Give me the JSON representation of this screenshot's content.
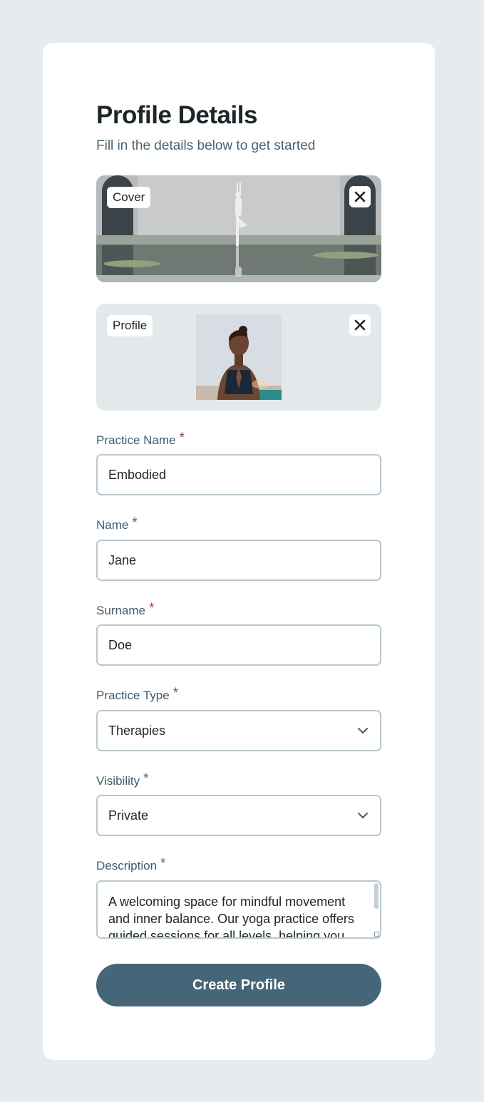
{
  "form": {
    "title": "Profile Details",
    "subtitle": "Fill in the details below to get started",
    "cover_label": "Cover",
    "profile_label": "Profile",
    "required_mark": "*",
    "fields": {
      "practice_name": {
        "label": "Practice Name",
        "value": "Embodied"
      },
      "name": {
        "label": "Name",
        "value": "Jane"
      },
      "surname": {
        "label": "Surname",
        "value": "Doe"
      },
      "practice_type": {
        "label": "Practice Type",
        "value": "Therapies"
      },
      "visibility": {
        "label": "Visibility",
        "value": "Private"
      },
      "description": {
        "label": "Description",
        "value": "A welcoming space for mindful movement and inner balance. Our yoga practice offers guided sessions for all levels, helping you"
      }
    },
    "submit_label": "Create Profile"
  },
  "icons": {
    "close": "close-icon",
    "chevron": "chevron-down-icon"
  },
  "colors": {
    "background": "#e7ebee",
    "card": "#ffffff",
    "accent": "#456678",
    "label": "#3f5b6d",
    "required": "#8b4a5b",
    "border": "#b9c8cf"
  }
}
